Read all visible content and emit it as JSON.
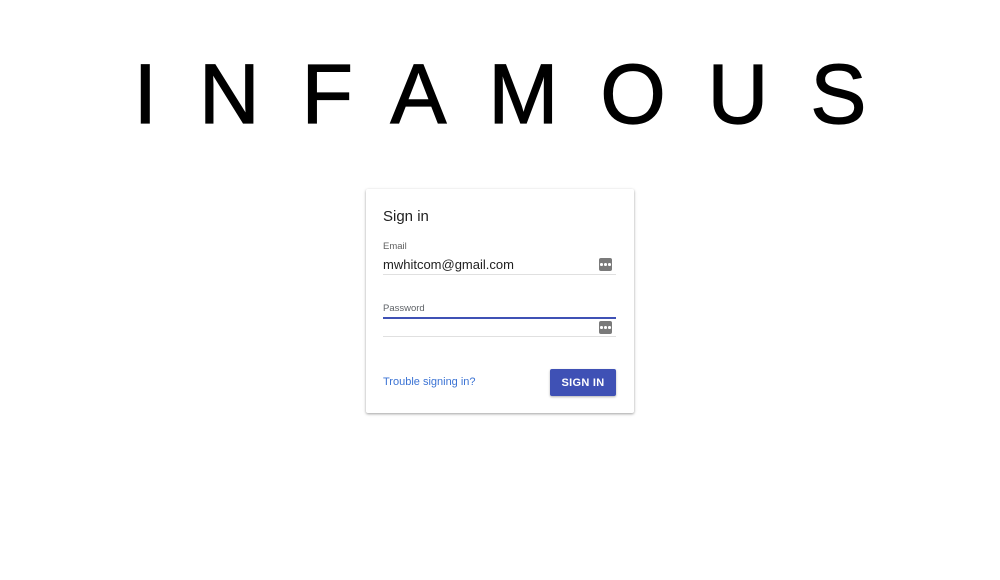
{
  "brand": {
    "title": "INFAMOUS"
  },
  "signin_card": {
    "title": "Sign in",
    "email": {
      "label": "Email",
      "value": "mwhitcom@gmail.com",
      "icon": "password-manager-key-icon"
    },
    "password": {
      "label": "Password",
      "value": "",
      "icon": "password-manager-key-icon"
    },
    "trouble_link": "Trouble signing in?",
    "submit_label": "SIGN IN"
  },
  "colors": {
    "accent": "#3f51b5",
    "link": "#3b73d4",
    "background": "#ffffff"
  }
}
